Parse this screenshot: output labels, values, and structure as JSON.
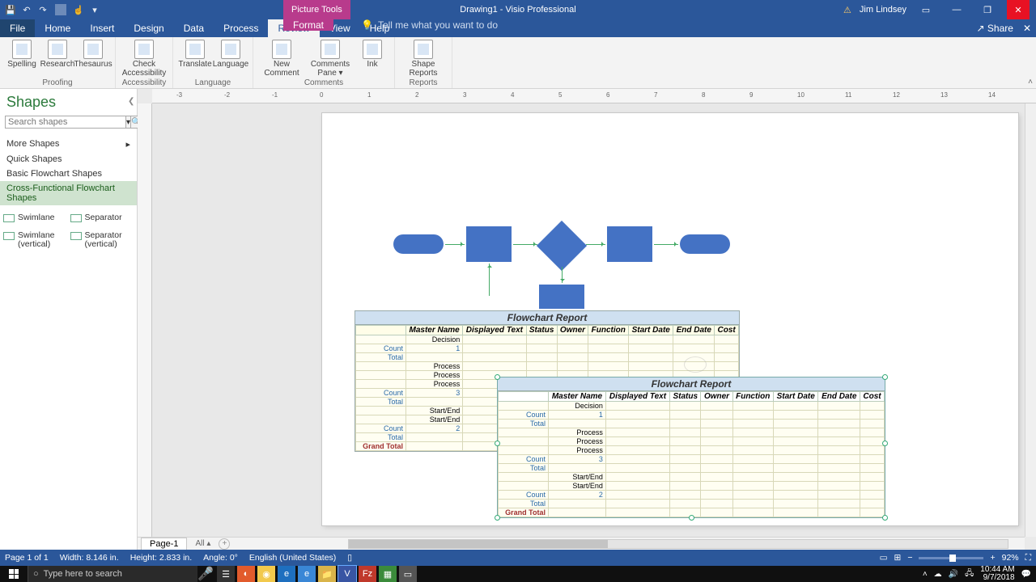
{
  "title": {
    "context_tool": "Picture Tools",
    "document": "Drawing1 - Visio Professional",
    "user": "Jim Lindsey"
  },
  "tabs": {
    "file": "File",
    "items": [
      "Home",
      "Insert",
      "Design",
      "Data",
      "Process",
      "Review",
      "View",
      "Help"
    ],
    "active": "Review",
    "format": "Format",
    "tellme_placeholder": "Tell me what you want to do",
    "share": "Share"
  },
  "ribbon": {
    "groups": [
      {
        "label": "Proofing",
        "buttons": [
          "Spelling",
          "Research",
          "Thesaurus"
        ]
      },
      {
        "label": "Accessibility",
        "buttons": [
          "Check\nAccessibility"
        ]
      },
      {
        "label": "Language",
        "buttons": [
          "Translate",
          "Language"
        ]
      },
      {
        "label": "Comments",
        "buttons": [
          "New\nComment",
          "Comments\nPane ▾",
          "Ink"
        ]
      },
      {
        "label": "Reports",
        "buttons": [
          "Shape\nReports"
        ]
      }
    ]
  },
  "shapes_pane": {
    "title": "Shapes",
    "search_placeholder": "Search shapes",
    "stencils": {
      "more": "More Shapes",
      "items": [
        "Quick Shapes",
        "Basic Flowchart Shapes",
        "Cross-Functional Flowchart Shapes"
      ],
      "active": "Cross-Functional Flowchart Shapes"
    },
    "shapes": [
      "Swimlane",
      "Separator",
      "Swimlane (vertical)",
      "Separator (vertical)"
    ]
  },
  "report1": {
    "title": "Flowchart Report",
    "headers": [
      "Master Name",
      "Displayed Text",
      "Status",
      "Owner",
      "Function",
      "Start Date",
      "End Date",
      "Cost"
    ],
    "groups": [
      {
        "rows": [
          "Decision"
        ],
        "count_label": "Count",
        "count": "1",
        "total_label": "Total"
      },
      {
        "rows": [
          "Process",
          "Process",
          "Process"
        ],
        "count_label": "Count",
        "count": "3",
        "total_label": "Total"
      },
      {
        "rows": [
          "Start/End",
          "Start/End"
        ],
        "count_label": "Count",
        "count": "2",
        "total_label": "Total"
      }
    ],
    "grand_total": "Grand Total"
  },
  "report2": {
    "title": "Flowchart Report",
    "headers": [
      "Master Name",
      "Displayed Text",
      "Status",
      "Owner",
      "Function",
      "Start Date",
      "End Date",
      "Cost"
    ],
    "groups": [
      {
        "rows": [
          "Decision"
        ],
        "count_label": "Count",
        "count": "1",
        "total_label": "Total"
      },
      {
        "rows": [
          "Process",
          "Process",
          "Process"
        ],
        "count_label": "Count",
        "count": "3",
        "total_label": "Total"
      },
      {
        "rows": [
          "Start/End",
          "Start/End"
        ],
        "count_label": "Count",
        "count": "2",
        "total_label": "Total"
      }
    ],
    "grand_total": "Grand Total"
  },
  "sheet_tabs": {
    "page": "Page-1",
    "all": "All ▴"
  },
  "statusbar": {
    "page": "Page 1 of 1",
    "width": "Width: 8.146 in.",
    "height": "Height: 2.833 in.",
    "angle": "Angle: 0°",
    "lang": "English (United States)",
    "zoom": "92%"
  },
  "taskbar": {
    "search_placeholder": "Type here to search",
    "time": "10:44 AM",
    "date": "9/7/2018"
  },
  "ruler_ticks": [
    "-3",
    "-2",
    "-1",
    "0",
    "1",
    "2",
    "3",
    "4",
    "5",
    "6",
    "7",
    "8",
    "9",
    "10",
    "11",
    "12",
    "13",
    "14"
  ]
}
